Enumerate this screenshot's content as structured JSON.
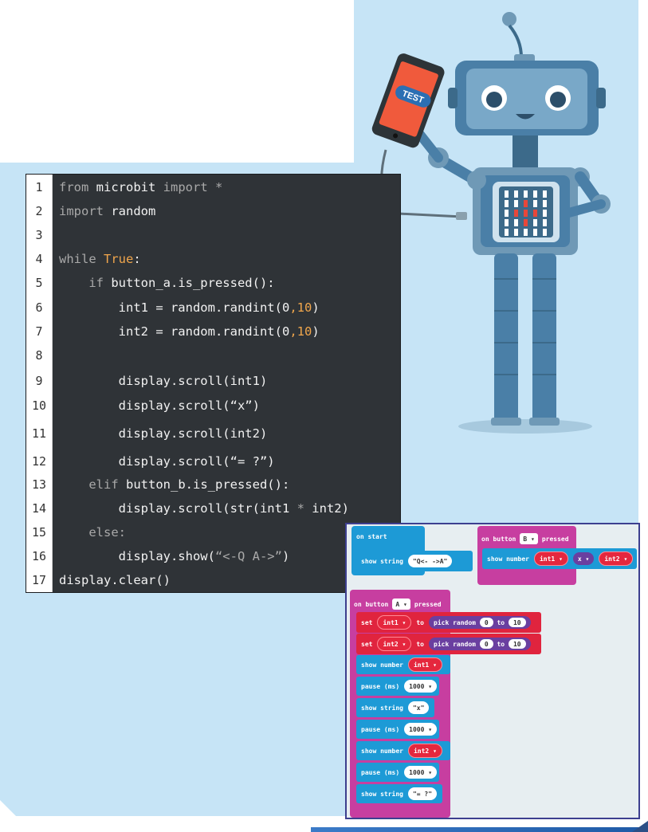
{
  "code_editor": {
    "line_numbers": [
      "1",
      "2",
      "3",
      "4",
      "5",
      "6",
      "7",
      "8",
      "9",
      "10",
      "11",
      "12",
      "13",
      "14",
      "15",
      "16",
      "17"
    ],
    "lines": [
      [
        {
          "t": "from ",
          "c": "kw"
        },
        {
          "t": "microbit ",
          "c": ""
        },
        {
          "t": "import *",
          "c": "kw"
        }
      ],
      [
        {
          "t": "import ",
          "c": "kw"
        },
        {
          "t": "random",
          "c": ""
        }
      ],
      [],
      [
        {
          "t": "while ",
          "c": "kw"
        },
        {
          "t": "True",
          "c": "tv"
        },
        {
          "t": ":",
          "c": ""
        }
      ],
      [
        {
          "t": "    if ",
          "c": "kw"
        },
        {
          "t": "button_a.is_pressed():",
          "c": ""
        }
      ],
      [
        {
          "t": "        int1 = random.randint(",
          "c": ""
        },
        {
          "t": "0",
          "c": ""
        },
        {
          "t": ",",
          "c": "num"
        },
        {
          "t": "10",
          "c": "num"
        },
        {
          "t": ")",
          "c": ""
        }
      ],
      [
        {
          "t": "        int2 = random.randint(",
          "c": ""
        },
        {
          "t": "0",
          "c": ""
        },
        {
          "t": ",",
          "c": "num"
        },
        {
          "t": "10",
          "c": "num"
        },
        {
          "t": ")",
          "c": ""
        }
      ],
      [],
      [
        {
          "t": "        display.scroll(int1)",
          "c": ""
        }
      ],
      [
        {
          "t": "        display.scroll(“x”)",
          "c": ""
        }
      ],
      [
        {
          "t": "        display.scroll(int2)",
          "c": ""
        }
      ],
      [
        {
          "t": "        display.scroll(“= ?”)",
          "c": ""
        }
      ],
      [
        {
          "t": "    elif ",
          "c": "kw"
        },
        {
          "t": "button_b.is_pressed():",
          "c": ""
        }
      ],
      [
        {
          "t": "        display.scroll(str(int1 ",
          "c": ""
        },
        {
          "t": "*",
          "c": "kw"
        },
        {
          "t": " int2)",
          "c": ""
        }
      ],
      [
        {
          "t": "    else:",
          "c": "kw"
        }
      ],
      [
        {
          "t": "        display.show(",
          "c": ""
        },
        {
          "t": "“<-Q A->”",
          "c": "kw"
        },
        {
          "t": ")",
          "c": ""
        }
      ],
      [
        {
          "t": "display.clear()",
          "c": ""
        }
      ]
    ]
  },
  "blocks": {
    "on_start": {
      "label": "on start",
      "show_string_label": "show string",
      "string_value": "\"Q<-    ->A\""
    },
    "on_button_b": {
      "label_prefix": "on button",
      "button": "B",
      "label_suffix": "pressed",
      "show_number_label": "show number",
      "var1": "int1",
      "op": "x",
      "var2": "int2"
    },
    "on_button_a": {
      "label_prefix": "on button",
      "button": "A",
      "label_suffix": "pressed",
      "set_label": "set",
      "to_label": "to",
      "pick_random_label": "pick random",
      "range_from": "0",
      "range_to_label": "to",
      "range_to": "10",
      "var1": "int1",
      "var2": "int2",
      "show_number_label": "show number",
      "show_string_label": "show string",
      "pause_label": "pause (ms)",
      "pause_value": "1000",
      "string_x": "\"x\"",
      "string_eq": "\"= ?\""
    }
  },
  "illustration": {
    "phone_badge": "TEST"
  },
  "colors": {
    "background_panel": "#c6e4f6",
    "code_bg": "#2f3337",
    "block_blue": "#1d9ad6",
    "block_red": "#e0243e",
    "block_pink": "#c73ea0",
    "block_purple": "#6a3fa0"
  }
}
